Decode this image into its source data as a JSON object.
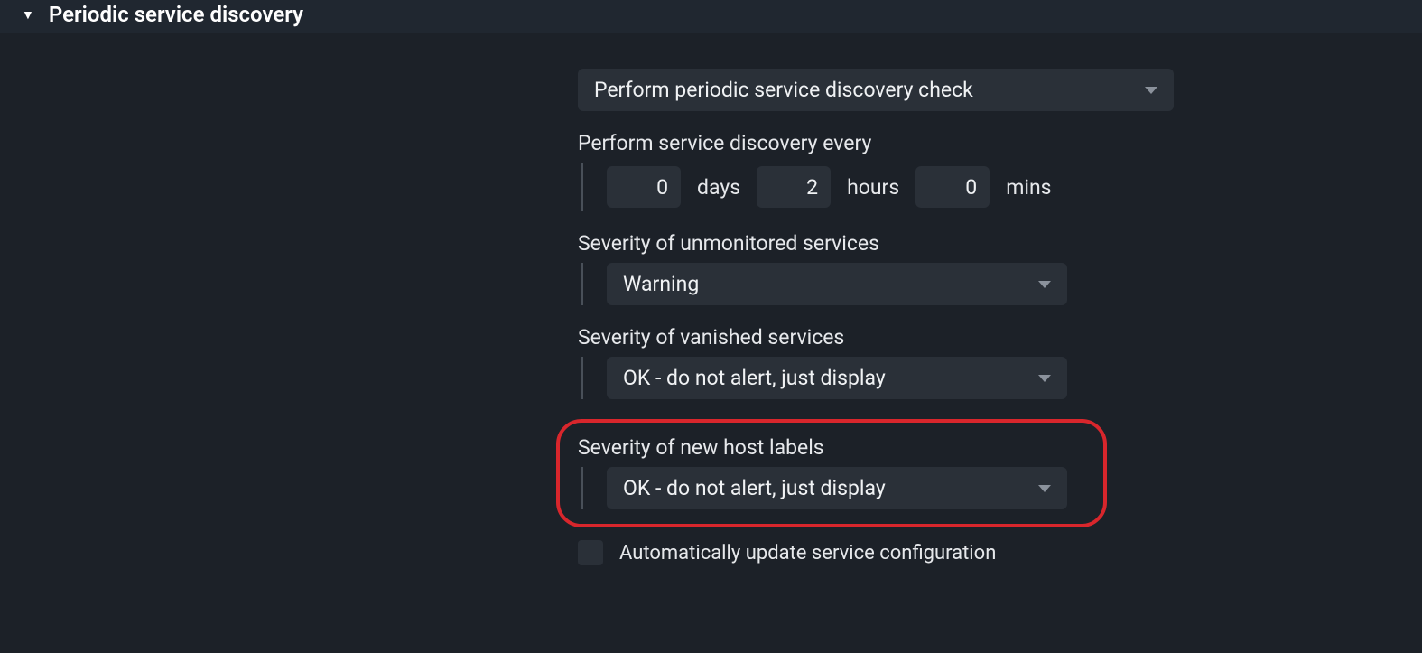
{
  "section": {
    "title": "Periodic service discovery"
  },
  "mode_dropdown": {
    "value": "Perform periodic service discovery check"
  },
  "interval": {
    "label": "Perform service discovery every",
    "days_value": "0",
    "days_unit": "days",
    "hours_value": "2",
    "hours_unit": "hours",
    "mins_value": "0",
    "mins_unit": "mins"
  },
  "unmonitored": {
    "label": "Severity of unmonitored services",
    "value": "Warning"
  },
  "vanished": {
    "label": "Severity of vanished services",
    "value": "OK - do not alert, just display"
  },
  "new_host_labels": {
    "label": "Severity of new host labels",
    "value": "OK - do not alert, just display"
  },
  "auto_update": {
    "label": "Automatically update service configuration"
  }
}
